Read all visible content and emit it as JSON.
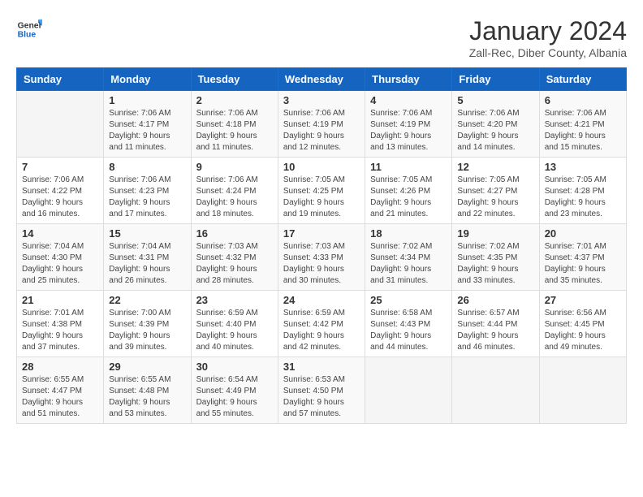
{
  "header": {
    "logo_line1": "General",
    "logo_line2": "Blue",
    "month_title": "January 2024",
    "subtitle": "Zall-Rec, Diber County, Albania"
  },
  "weekdays": [
    "Sunday",
    "Monday",
    "Tuesday",
    "Wednesday",
    "Thursday",
    "Friday",
    "Saturday"
  ],
  "weeks": [
    [
      {
        "num": "",
        "sunrise": "",
        "sunset": "",
        "daylight": ""
      },
      {
        "num": "1",
        "sunrise": "Sunrise: 7:06 AM",
        "sunset": "Sunset: 4:17 PM",
        "daylight": "Daylight: 9 hours and 11 minutes."
      },
      {
        "num": "2",
        "sunrise": "Sunrise: 7:06 AM",
        "sunset": "Sunset: 4:18 PM",
        "daylight": "Daylight: 9 hours and 11 minutes."
      },
      {
        "num": "3",
        "sunrise": "Sunrise: 7:06 AM",
        "sunset": "Sunset: 4:19 PM",
        "daylight": "Daylight: 9 hours and 12 minutes."
      },
      {
        "num": "4",
        "sunrise": "Sunrise: 7:06 AM",
        "sunset": "Sunset: 4:19 PM",
        "daylight": "Daylight: 9 hours and 13 minutes."
      },
      {
        "num": "5",
        "sunrise": "Sunrise: 7:06 AM",
        "sunset": "Sunset: 4:20 PM",
        "daylight": "Daylight: 9 hours and 14 minutes."
      },
      {
        "num": "6",
        "sunrise": "Sunrise: 7:06 AM",
        "sunset": "Sunset: 4:21 PM",
        "daylight": "Daylight: 9 hours and 15 minutes."
      }
    ],
    [
      {
        "num": "7",
        "sunrise": "Sunrise: 7:06 AM",
        "sunset": "Sunset: 4:22 PM",
        "daylight": "Daylight: 9 hours and 16 minutes."
      },
      {
        "num": "8",
        "sunrise": "Sunrise: 7:06 AM",
        "sunset": "Sunset: 4:23 PM",
        "daylight": "Daylight: 9 hours and 17 minutes."
      },
      {
        "num": "9",
        "sunrise": "Sunrise: 7:06 AM",
        "sunset": "Sunset: 4:24 PM",
        "daylight": "Daylight: 9 hours and 18 minutes."
      },
      {
        "num": "10",
        "sunrise": "Sunrise: 7:05 AM",
        "sunset": "Sunset: 4:25 PM",
        "daylight": "Daylight: 9 hours and 19 minutes."
      },
      {
        "num": "11",
        "sunrise": "Sunrise: 7:05 AM",
        "sunset": "Sunset: 4:26 PM",
        "daylight": "Daylight: 9 hours and 21 minutes."
      },
      {
        "num": "12",
        "sunrise": "Sunrise: 7:05 AM",
        "sunset": "Sunset: 4:27 PM",
        "daylight": "Daylight: 9 hours and 22 minutes."
      },
      {
        "num": "13",
        "sunrise": "Sunrise: 7:05 AM",
        "sunset": "Sunset: 4:28 PM",
        "daylight": "Daylight: 9 hours and 23 minutes."
      }
    ],
    [
      {
        "num": "14",
        "sunrise": "Sunrise: 7:04 AM",
        "sunset": "Sunset: 4:30 PM",
        "daylight": "Daylight: 9 hours and 25 minutes."
      },
      {
        "num": "15",
        "sunrise": "Sunrise: 7:04 AM",
        "sunset": "Sunset: 4:31 PM",
        "daylight": "Daylight: 9 hours and 26 minutes."
      },
      {
        "num": "16",
        "sunrise": "Sunrise: 7:03 AM",
        "sunset": "Sunset: 4:32 PM",
        "daylight": "Daylight: 9 hours and 28 minutes."
      },
      {
        "num": "17",
        "sunrise": "Sunrise: 7:03 AM",
        "sunset": "Sunset: 4:33 PM",
        "daylight": "Daylight: 9 hours and 30 minutes."
      },
      {
        "num": "18",
        "sunrise": "Sunrise: 7:02 AM",
        "sunset": "Sunset: 4:34 PM",
        "daylight": "Daylight: 9 hours and 31 minutes."
      },
      {
        "num": "19",
        "sunrise": "Sunrise: 7:02 AM",
        "sunset": "Sunset: 4:35 PM",
        "daylight": "Daylight: 9 hours and 33 minutes."
      },
      {
        "num": "20",
        "sunrise": "Sunrise: 7:01 AM",
        "sunset": "Sunset: 4:37 PM",
        "daylight": "Daylight: 9 hours and 35 minutes."
      }
    ],
    [
      {
        "num": "21",
        "sunrise": "Sunrise: 7:01 AM",
        "sunset": "Sunset: 4:38 PM",
        "daylight": "Daylight: 9 hours and 37 minutes."
      },
      {
        "num": "22",
        "sunrise": "Sunrise: 7:00 AM",
        "sunset": "Sunset: 4:39 PM",
        "daylight": "Daylight: 9 hours and 39 minutes."
      },
      {
        "num": "23",
        "sunrise": "Sunrise: 6:59 AM",
        "sunset": "Sunset: 4:40 PM",
        "daylight": "Daylight: 9 hours and 40 minutes."
      },
      {
        "num": "24",
        "sunrise": "Sunrise: 6:59 AM",
        "sunset": "Sunset: 4:42 PM",
        "daylight": "Daylight: 9 hours and 42 minutes."
      },
      {
        "num": "25",
        "sunrise": "Sunrise: 6:58 AM",
        "sunset": "Sunset: 4:43 PM",
        "daylight": "Daylight: 9 hours and 44 minutes."
      },
      {
        "num": "26",
        "sunrise": "Sunrise: 6:57 AM",
        "sunset": "Sunset: 4:44 PM",
        "daylight": "Daylight: 9 hours and 46 minutes."
      },
      {
        "num": "27",
        "sunrise": "Sunrise: 6:56 AM",
        "sunset": "Sunset: 4:45 PM",
        "daylight": "Daylight: 9 hours and 49 minutes."
      }
    ],
    [
      {
        "num": "28",
        "sunrise": "Sunrise: 6:55 AM",
        "sunset": "Sunset: 4:47 PM",
        "daylight": "Daylight: 9 hours and 51 minutes."
      },
      {
        "num": "29",
        "sunrise": "Sunrise: 6:55 AM",
        "sunset": "Sunset: 4:48 PM",
        "daylight": "Daylight: 9 hours and 53 minutes."
      },
      {
        "num": "30",
        "sunrise": "Sunrise: 6:54 AM",
        "sunset": "Sunset: 4:49 PM",
        "daylight": "Daylight: 9 hours and 55 minutes."
      },
      {
        "num": "31",
        "sunrise": "Sunrise: 6:53 AM",
        "sunset": "Sunset: 4:50 PM",
        "daylight": "Daylight: 9 hours and 57 minutes."
      },
      {
        "num": "",
        "sunrise": "",
        "sunset": "",
        "daylight": ""
      },
      {
        "num": "",
        "sunrise": "",
        "sunset": "",
        "daylight": ""
      },
      {
        "num": "",
        "sunrise": "",
        "sunset": "",
        "daylight": ""
      }
    ]
  ]
}
